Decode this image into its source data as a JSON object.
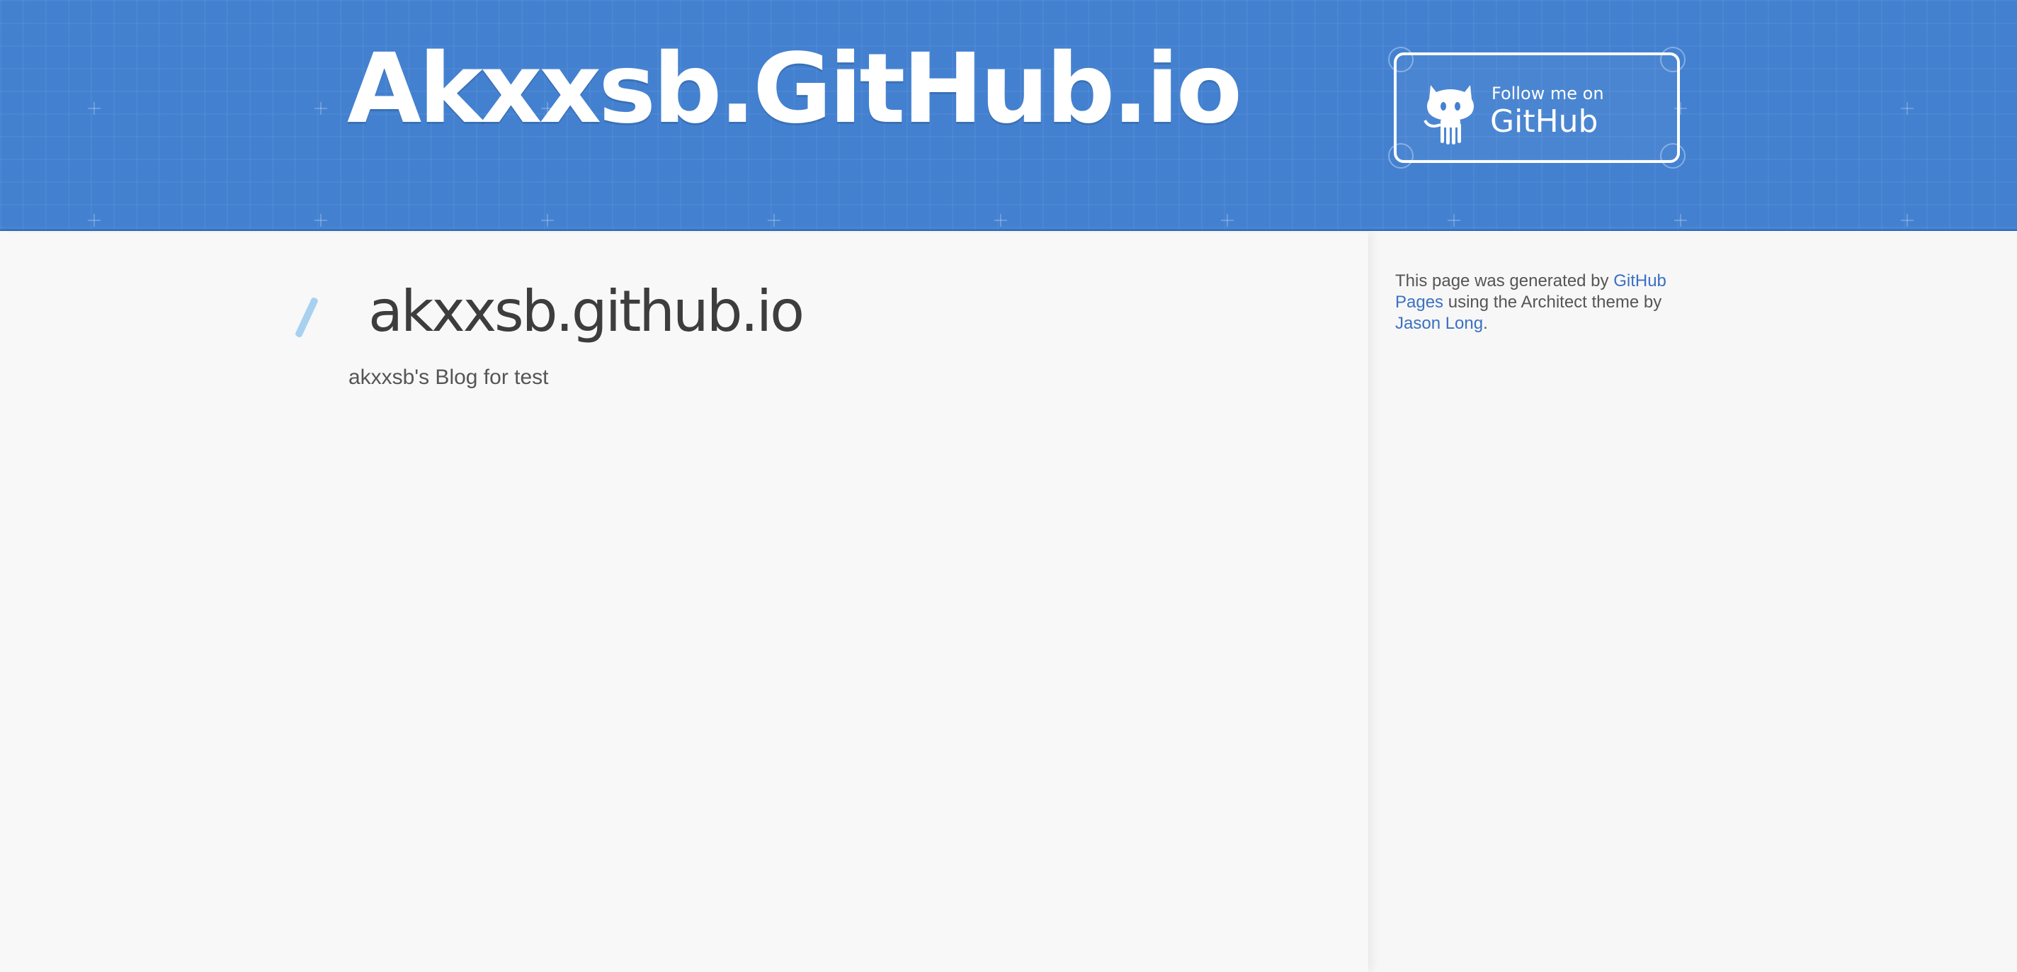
{
  "header": {
    "site_title": "Akxxsb.GitHub.io",
    "follow_button": {
      "small_label": "Follow me on",
      "big_label": "GitHub",
      "icon": "octocat-icon"
    }
  },
  "main": {
    "post_title": "akxxsb.github.io",
    "post_description": "akxxsb's Blog for test"
  },
  "sidebar": {
    "credit_prefix": "This page was generated by ",
    "github_pages_link": "GitHub Pages",
    "credit_middle": " using the Architect theme by ",
    "author_link": "Jason Long",
    "credit_suffix": "."
  },
  "colors": {
    "header_bg": "#4381d0",
    "link": "#3a71c1",
    "accent_slash": "#a8d1f0",
    "text": "#555555",
    "title_text": "#3d3d3d"
  }
}
